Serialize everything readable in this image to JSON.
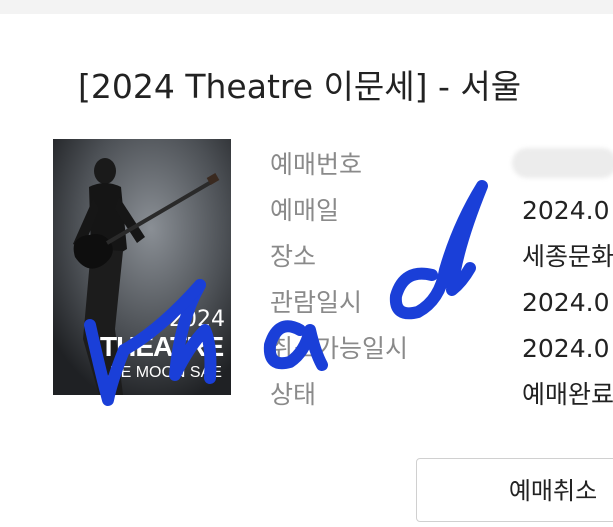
{
  "title": "[2024 Theatre 이문세]  - 서울",
  "poster": {
    "year": "2024",
    "name": "THEATRE",
    "artist": "LEE MOON SAE"
  },
  "details": {
    "labels": [
      "예매번호",
      "예매일",
      "장소",
      "관람일시",
      "취소가능일시",
      "상태"
    ],
    "values": [
      "",
      "2024.0",
      "세종문화",
      "2024.0",
      "2024.0",
      "예매완료"
    ]
  },
  "buttons": {
    "cancel": "예매취소"
  },
  "colors": {
    "label_gray": "#8a8a8a",
    "text_dark": "#222222",
    "scribble_blue": "#1a3fd8"
  }
}
